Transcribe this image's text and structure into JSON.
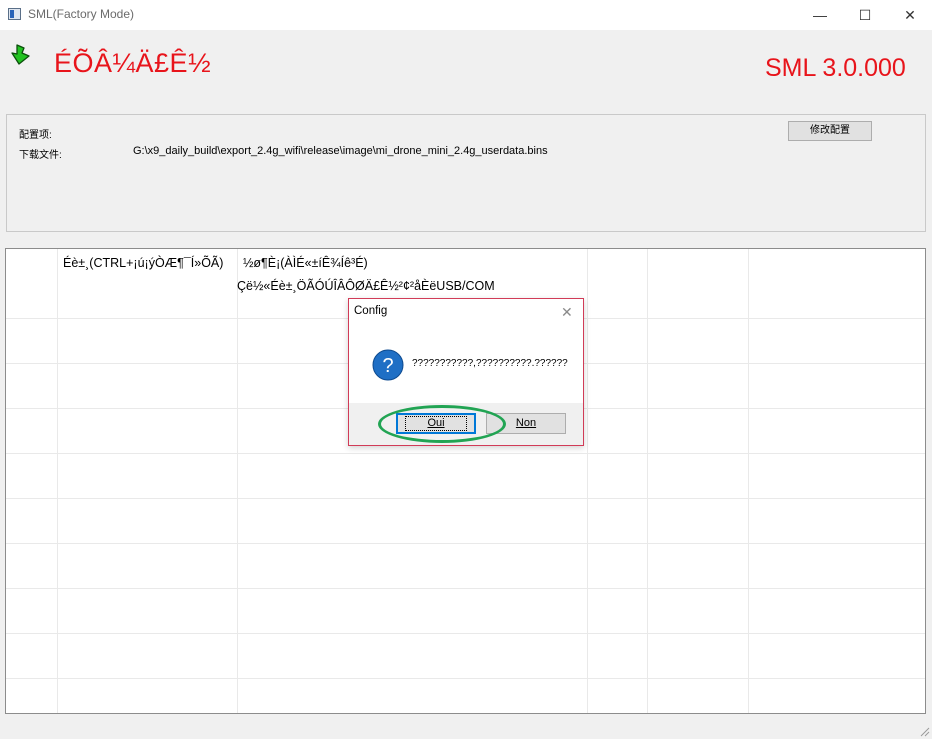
{
  "window": {
    "title": "SML(Factory Mode)",
    "controls": {
      "minimize": "—",
      "maximize": "☐",
      "close": "✕"
    }
  },
  "header": {
    "brand_title": "ÉÕÂ¼Ä£Ê½",
    "version": "SML 3.0.000",
    "brand_color": "#e8141b",
    "status_icon": "green-down-arrow-icon"
  },
  "config": {
    "config_item_label": "配置项:",
    "download_file_label": "下载文件:",
    "download_file_path": "G:\\x9_daily_build\\export_2.4g_wifi\\release\\image\\mi_drone_mini_2.4g_userdata.bins",
    "modify_button": "修改配置"
  },
  "grid": {
    "col1_header": "Éè±¸(CTRL+¡ú¡ýÒÆ¶¯Í»ÕÃ)",
    "col2_line1": "½ø¶È¡(ÀÌÉ«±íÊ¾Íê³É)",
    "col2_line2": "Çë½«Éè±¸ÖÃÓÚÎÂÔØÄ£Ê½²¢²åÈëUSB/COM"
  },
  "dialog": {
    "title": "Config",
    "close": "✕",
    "icon": "question-icon",
    "message": "???????????,??????????.??????",
    "yes_button": "Oui",
    "no_button": "Non",
    "accent_color": "#0078d7",
    "highlight_color": "#21a453"
  }
}
